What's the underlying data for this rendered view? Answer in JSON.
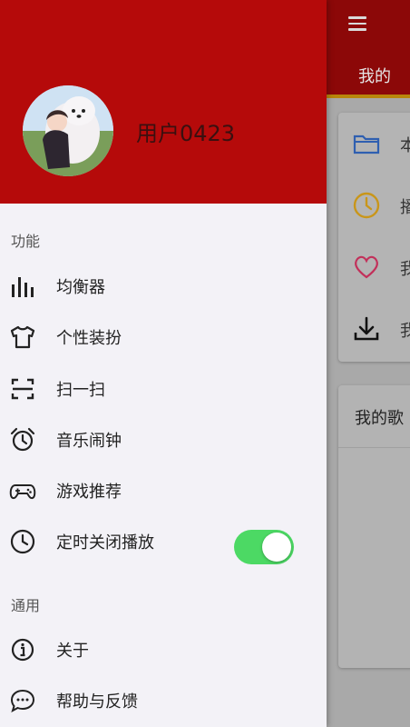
{
  "background": {
    "menu_icon": "hamburger-icon",
    "tab_label": "我的",
    "list_items": [
      {
        "icon": "folder-icon",
        "text": "本"
      },
      {
        "icon": "clock-icon",
        "text": "播"
      },
      {
        "icon": "heart-icon",
        "text": "我"
      },
      {
        "icon": "download-icon",
        "text": "我"
      }
    ],
    "card_title": "我的歌"
  },
  "drawer": {
    "username": "用户0423",
    "sections": [
      {
        "label": "功能",
        "items": [
          {
            "icon": "equalizer-icon",
            "label": "均衡器"
          },
          {
            "icon": "tshirt-icon",
            "label": "个性装扮"
          },
          {
            "icon": "scan-icon",
            "label": "扫一扫"
          },
          {
            "icon": "alarm-clock-icon",
            "label": "音乐闹钟"
          },
          {
            "icon": "gamepad-icon",
            "label": "游戏推荐"
          },
          {
            "icon": "clock-icon",
            "label": "定时关闭播放",
            "toggle": true
          }
        ]
      },
      {
        "label": "通用",
        "items": [
          {
            "icon": "info-icon",
            "label": "关于"
          },
          {
            "icon": "chat-icon",
            "label": "帮助与反馈"
          }
        ]
      }
    ]
  },
  "colors": {
    "header": "#b50a0a",
    "toggle_on": "#4cd964",
    "drawer_bg": "#f3f2f7"
  }
}
